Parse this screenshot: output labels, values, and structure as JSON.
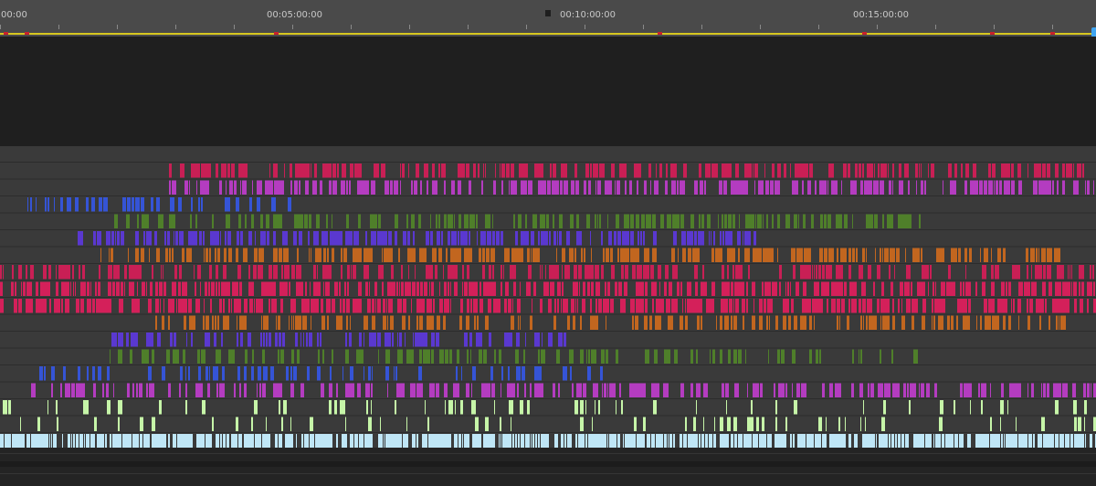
{
  "ruler": {
    "timecodes": [
      "00:00",
      "00:05:00:00",
      "00:10:00:00",
      "00:15:00:00"
    ]
  },
  "icons": {
    "playhead": "playhead-icon",
    "marker": "marker-icon"
  },
  "colors": {
    "ruler_bg": "#4a4a4a",
    "monitor_bg": "#1f1f1f",
    "track_bg": "#3a3a3a",
    "track_separator": "#2c2c2c",
    "work_area_bar": "#d6c720",
    "in_out_marker": "#c8212b",
    "playhead": "#3fa4f0",
    "clip_red": "#c91f55",
    "clip_magenta": "#b43cc0",
    "clip_blue": "#3554d6",
    "clip_green": "#4f7f2a",
    "clip_violet": "#5a38d0",
    "clip_orange": "#c2661f",
    "clip_pink": "#d04a78",
    "clip_lime": "#c6f5a8",
    "clip_cyan": "#bfe6f6",
    "clip_lavender": "#8f7bff"
  },
  "tracks": [
    {
      "segments": [
        [
          185,
          1200
        ]
      ],
      "color": "#c91f55",
      "density": 0.55
    },
    {
      "segments": [
        [
          185,
          1200
        ]
      ],
      "color": "#b43cc0",
      "density": 0.6
    },
    {
      "segments": [
        [
          30,
          330
        ]
      ],
      "color": "#3554d6",
      "density": 0.35
    },
    {
      "segments": [
        [
          120,
          1008
        ]
      ],
      "color": "#4f7f2a",
      "density": 0.5
    },
    {
      "segments": [
        [
          85,
          830
        ]
      ],
      "color": "#5a38d0",
      "density": 0.55
    },
    {
      "segments": [
        [
          110,
          1165
        ]
      ],
      "color": "#c2661f",
      "density": 0.55
    },
    {
      "segments": [
        [
          0,
          1200
        ]
      ],
      "color": "#c91f55",
      "density": 0.45
    },
    {
      "segments": [
        [
          0,
          1200
        ]
      ],
      "color": "#d4205a",
      "density": 0.65
    },
    {
      "segments": [
        [
          0,
          1200
        ]
      ],
      "color": "#d4205a",
      "density": 0.65
    },
    {
      "segments": [
        [
          170,
          1170
        ]
      ],
      "color": "#c2661f",
      "density": 0.45
    },
    {
      "segments": [
        [
          120,
          620
        ]
      ],
      "color": "#5a38d0",
      "density": 0.45
    },
    {
      "segments": [
        [
          120,
          1005
        ]
      ],
      "color": "#4f7f2a",
      "density": 0.4
    },
    {
      "segments": [
        [
          30,
          660
        ]
      ],
      "color": "#3554d6",
      "density": 0.3
    },
    {
      "segments": [
        [
          30,
          1200
        ]
      ],
      "color": "#b43cc0",
      "density": 0.45
    },
    {
      "segments": [
        [
          0,
          1200
        ]
      ],
      "color": "#c6f5a8",
      "density": 0.15
    },
    {
      "segments": [
        [
          0,
          1200
        ]
      ],
      "color": "#c6f5a8",
      "density": 0.12
    },
    {
      "segments": [
        [
          0,
          1200
        ]
      ],
      "color": "#bfe6f6",
      "density": 0.85
    }
  ]
}
